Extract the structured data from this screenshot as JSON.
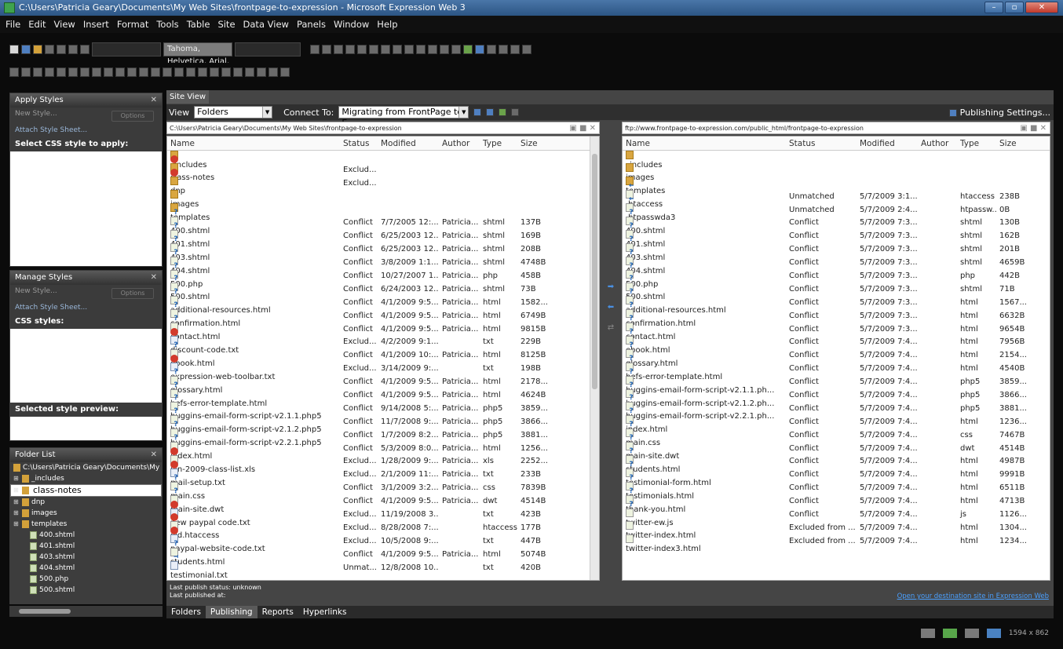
{
  "title": "C:\\Users\\Patricia Geary\\Documents\\My Web Sites\\frontpage-to-expression - Microsoft Expression Web 3",
  "menu": [
    "File",
    "Edit",
    "View",
    "Insert",
    "Format",
    "Tools",
    "Table",
    "Site",
    "Data View",
    "Panels",
    "Window",
    "Help"
  ],
  "toolbar": {
    "font_family": "Tahoma, Helvetica, Arial, "
  },
  "panels": {
    "apply_styles": {
      "title": "Apply Styles",
      "new_style": "New Style...",
      "options": "Options",
      "attach": "Attach Style Sheet...",
      "select_label": "Select CSS style to apply:"
    },
    "manage_styles": {
      "title": "Manage Styles",
      "new_style": "New Style...",
      "options": "Options",
      "attach": "Attach Style Sheet...",
      "css_styles": "CSS styles:",
      "preview": "Selected style preview:"
    },
    "folder_list": {
      "title": "Folder List",
      "root": "C:\\Users\\Patricia Geary\\Documents\\My",
      "items": [
        {
          "label": "_includes",
          "type": "folder"
        },
        {
          "label": "class-notes",
          "type": "folder",
          "selected": true
        },
        {
          "label": "dnp",
          "type": "folder"
        },
        {
          "label": "images",
          "type": "folder"
        },
        {
          "label": "templates",
          "type": "folder"
        },
        {
          "label": "400.shtml",
          "type": "file"
        },
        {
          "label": "401.shtml",
          "type": "file"
        },
        {
          "label": "403.shtml",
          "type": "file"
        },
        {
          "label": "404.shtml",
          "type": "file"
        },
        {
          "label": "500.php",
          "type": "file"
        },
        {
          "label": "500.shtml",
          "type": "file"
        }
      ]
    }
  },
  "site_view": {
    "tab": "Site View",
    "view_label": "View",
    "view_value": "Folders",
    "connect_label": "Connect To:",
    "connect_value": "Migrating from FrontPage to E",
    "publishing_settings": "Publishing Settings...",
    "local_path": "C:\\Users\\Patricia Geary\\Documents\\My Web Sites\\frontpage-to-expression",
    "remote_path": "ftp://www.frontpage-to-expression.com/public_html/frontpage-to-expression",
    "columns": [
      "Name",
      "Status",
      "Modified",
      "Author",
      "Type",
      "Size"
    ],
    "local_files": [
      [
        "",
        "_includes",
        "",
        "",
        "",
        "",
        "",
        "folder"
      ],
      [
        "x",
        "class-notes",
        "Exclud...",
        "",
        "",
        "",
        "",
        "folder"
      ],
      [
        "x",
        "dnp",
        "Exclud...",
        "",
        "",
        "",
        "",
        "folder"
      ],
      [
        "",
        "images",
        "",
        "",
        "",
        "",
        "",
        "folder"
      ],
      [
        "",
        "templates",
        "",
        "",
        "",
        "",
        "",
        "folder"
      ],
      [
        "?",
        "400.shtml",
        "Conflict",
        "7/7/2005 12:...",
        "Patricia...",
        "shtml",
        "137B",
        "file"
      ],
      [
        "?",
        "401.shtml",
        "Conflict",
        "6/25/2003 12...",
        "Patricia...",
        "shtml",
        "169B",
        "file"
      ],
      [
        "?",
        "403.shtml",
        "Conflict",
        "6/25/2003 12...",
        "Patricia...",
        "shtml",
        "208B",
        "file"
      ],
      [
        "?",
        "404.shtml",
        "Conflict",
        "3/8/2009 1:1...",
        "Patricia...",
        "shtml",
        "4748B",
        "file"
      ],
      [
        "?",
        "500.php",
        "Conflict",
        "10/27/2007 1...",
        "Patricia...",
        "php",
        "458B",
        "file"
      ],
      [
        "?",
        "500.shtml",
        "Conflict",
        "6/24/2003 12...",
        "Patricia...",
        "shtml",
        "73B",
        "file"
      ],
      [
        "?",
        "additional-resources.html",
        "Conflict",
        "4/1/2009 9:5...",
        "Patricia...",
        "html",
        "1582...",
        "file"
      ],
      [
        "?",
        "confirmation.html",
        "Conflict",
        "4/1/2009 9:5...",
        "Patricia...",
        "html",
        "6749B",
        "file"
      ],
      [
        "?",
        "contact.html",
        "Conflict",
        "4/1/2009 9:5...",
        "Patricia...",
        "html",
        "9815B",
        "file"
      ],
      [
        "x",
        "discount-code.txt",
        "Exclud...",
        "4/2/2009 9:1...",
        "",
        "txt",
        "229B",
        "txt"
      ],
      [
        "?",
        "ebook.html",
        "Conflict",
        "4/1/2009 10:...",
        "Patricia...",
        "html",
        "8125B",
        "file"
      ],
      [
        "x",
        "expression-web-toolbar.txt",
        "Exclud...",
        "3/14/2009 9:...",
        "",
        "txt",
        "198B",
        "txt"
      ],
      [
        "?",
        "glossary.html",
        "Conflict",
        "4/1/2009 9:5...",
        "Patricia...",
        "html",
        "2178...",
        "file"
      ],
      [
        "?",
        "hefs-error-template.html",
        "Conflict",
        "4/1/2009 9:5...",
        "Patricia...",
        "html",
        "4624B",
        "file"
      ],
      [
        "?",
        "huggins-email-form-script-v2.1.1.php5",
        "Conflict",
        "9/14/2008 5:...",
        "Patricia...",
        "php5",
        "3859...",
        "file"
      ],
      [
        "?",
        "huggins-email-form-script-v2.1.2.php5",
        "Conflict",
        "11/7/2008 9:...",
        "Patricia...",
        "php5",
        "3866...",
        "file"
      ],
      [
        "?",
        "huggins-email-form-script-v2.2.1.php5",
        "Conflict",
        "1/7/2009 8:2...",
        "Patricia...",
        "php5",
        "3881...",
        "file"
      ],
      [
        "?",
        "index.html",
        "Conflict",
        "5/3/2009 8:0...",
        "Patricia...",
        "html",
        "1256...",
        "file"
      ],
      [
        "x",
        "jan-2009-class-list.xls",
        "Exclud...",
        "1/28/2009 9:...",
        "Patricia...",
        "xls",
        "2252...",
        "file"
      ],
      [
        "x",
        "mail-setup.txt",
        "Exclud...",
        "2/1/2009 11:...",
        "Patricia...",
        "txt",
        "233B",
        "txt"
      ],
      [
        "?",
        "main.css",
        "Conflict",
        "3/1/2009 3:2...",
        "Patricia...",
        "css",
        "7839B",
        "file"
      ],
      [
        "?",
        "main-site.dwt",
        "Conflict",
        "4/1/2009 9:5...",
        "Patricia...",
        "dwt",
        "4514B",
        "file"
      ],
      [
        "x",
        "new paypal code.txt",
        "Exclud...",
        "11/19/2008 3...",
        "",
        "txt",
        "423B",
        "txt"
      ],
      [
        "x",
        "old.htaccess",
        "Exclud...",
        "8/28/2008 7:...",
        "",
        "htaccess",
        "177B",
        "file"
      ],
      [
        "x",
        "paypal-website-code.txt",
        "Exclud...",
        "10/5/2008 9:...",
        "",
        "txt",
        "447B",
        "txt"
      ],
      [
        "?",
        "students.html",
        "Conflict",
        "4/1/2009 9:5...",
        "Patricia...",
        "html",
        "5074B",
        "file"
      ],
      [
        "→",
        "testimonial.txt",
        "Unmat...",
        "12/8/2008 10...",
        "",
        "txt",
        "420B",
        "txt"
      ]
    ],
    "remote_files": [
      [
        "",
        "_includes",
        "",
        "",
        "",
        "",
        "",
        "folder"
      ],
      [
        "",
        "images",
        "",
        "",
        "",
        "",
        "",
        "folder"
      ],
      [
        "",
        "templates",
        "",
        "",
        "",
        "",
        "",
        "folder"
      ],
      [
        "←",
        ".htaccess",
        "Unmatched",
        "5/7/2009 3:1...",
        "",
        "htaccess",
        "238B",
        "file"
      ],
      [
        "←",
        ".htpasswda3",
        "Unmatched",
        "5/7/2009 2:4...",
        "",
        "htpassw...",
        "0B",
        "file"
      ],
      [
        "?",
        "400.shtml",
        "Conflict",
        "5/7/2009 7:3...",
        "",
        "shtml",
        "130B",
        "file"
      ],
      [
        "?",
        "401.shtml",
        "Conflict",
        "5/7/2009 7:3...",
        "",
        "shtml",
        "162B",
        "file"
      ],
      [
        "?",
        "403.shtml",
        "Conflict",
        "5/7/2009 7:3...",
        "",
        "shtml",
        "201B",
        "file"
      ],
      [
        "?",
        "404.shtml",
        "Conflict",
        "5/7/2009 7:3...",
        "",
        "shtml",
        "4659B",
        "file"
      ],
      [
        "?",
        "500.php",
        "Conflict",
        "5/7/2009 7:3...",
        "",
        "php",
        "442B",
        "file"
      ],
      [
        "?",
        "500.shtml",
        "Conflict",
        "5/7/2009 7:3...",
        "",
        "shtml",
        "71B",
        "file"
      ],
      [
        "?",
        "additional-resources.html",
        "Conflict",
        "5/7/2009 7:3...",
        "",
        "html",
        "1567...",
        "file"
      ],
      [
        "?",
        "confirmation.html",
        "Conflict",
        "5/7/2009 7:3...",
        "",
        "html",
        "6632B",
        "file"
      ],
      [
        "?",
        "contact.html",
        "Conflict",
        "5/7/2009 7:3...",
        "",
        "html",
        "9654B",
        "file"
      ],
      [
        "?",
        "ebook.html",
        "Conflict",
        "5/7/2009 7:4...",
        "",
        "html",
        "7956B",
        "file"
      ],
      [
        "?",
        "glossary.html",
        "Conflict",
        "5/7/2009 7:4...",
        "",
        "html",
        "2154...",
        "file"
      ],
      [
        "?",
        "hefs-error-template.html",
        "Conflict",
        "5/7/2009 7:4...",
        "",
        "html",
        "4540B",
        "file"
      ],
      [
        "?",
        "huggins-email-form-script-v2.1.1.ph...",
        "Conflict",
        "5/7/2009 7:4...",
        "",
        "php5",
        "3859...",
        "file"
      ],
      [
        "?",
        "huggins-email-form-script-v2.1.2.ph...",
        "Conflict",
        "5/7/2009 7:4...",
        "",
        "php5",
        "3866...",
        "file"
      ],
      [
        "?",
        "huggins-email-form-script-v2.2.1.ph...",
        "Conflict",
        "5/7/2009 7:4...",
        "",
        "php5",
        "3881...",
        "file"
      ],
      [
        "?",
        "index.html",
        "Conflict",
        "5/7/2009 7:4...",
        "",
        "html",
        "1236...",
        "file"
      ],
      [
        "?",
        "main.css",
        "Conflict",
        "5/7/2009 7:4...",
        "",
        "css",
        "7467B",
        "file"
      ],
      [
        "?",
        "main-site.dwt",
        "Conflict",
        "5/7/2009 7:4...",
        "",
        "dwt",
        "4514B",
        "file"
      ],
      [
        "?",
        "students.html",
        "Conflict",
        "5/7/2009 7:4...",
        "",
        "html",
        "4987B",
        "file"
      ],
      [
        "?",
        "testimonial-form.html",
        "Conflict",
        "5/7/2009 7:4...",
        "",
        "html",
        "9991B",
        "file"
      ],
      [
        "?",
        "testimonials.html",
        "Conflict",
        "5/7/2009 7:4...",
        "",
        "html",
        "6511B",
        "file"
      ],
      [
        "?",
        "thank-you.html",
        "Conflict",
        "5/7/2009 7:4...",
        "",
        "html",
        "4713B",
        "file"
      ],
      [
        "?",
        "twitter-ew.js",
        "Conflict",
        "5/7/2009 7:4...",
        "",
        "js",
        "1126...",
        "file"
      ],
      [
        "",
        "twitter-index.html",
        "Excluded from ...",
        "5/7/2009 7:4...",
        "",
        "html",
        "1304...",
        "file"
      ],
      [
        "",
        "twitter-index3.html",
        "Excluded from ...",
        "5/7/2009 7:4...",
        "",
        "html",
        "1234...",
        "file"
      ]
    ],
    "last_publish_status": "Last publish status: unknown",
    "last_published_at": "Last published at:",
    "open_destination": "Open your destination site in Expression Web",
    "bottom_tabs": [
      "Folders",
      "Publishing",
      "Reports",
      "Hyperlinks"
    ],
    "active_bottom_tab": "Publishing"
  },
  "statusbar": {
    "size": "1594 x 862"
  }
}
